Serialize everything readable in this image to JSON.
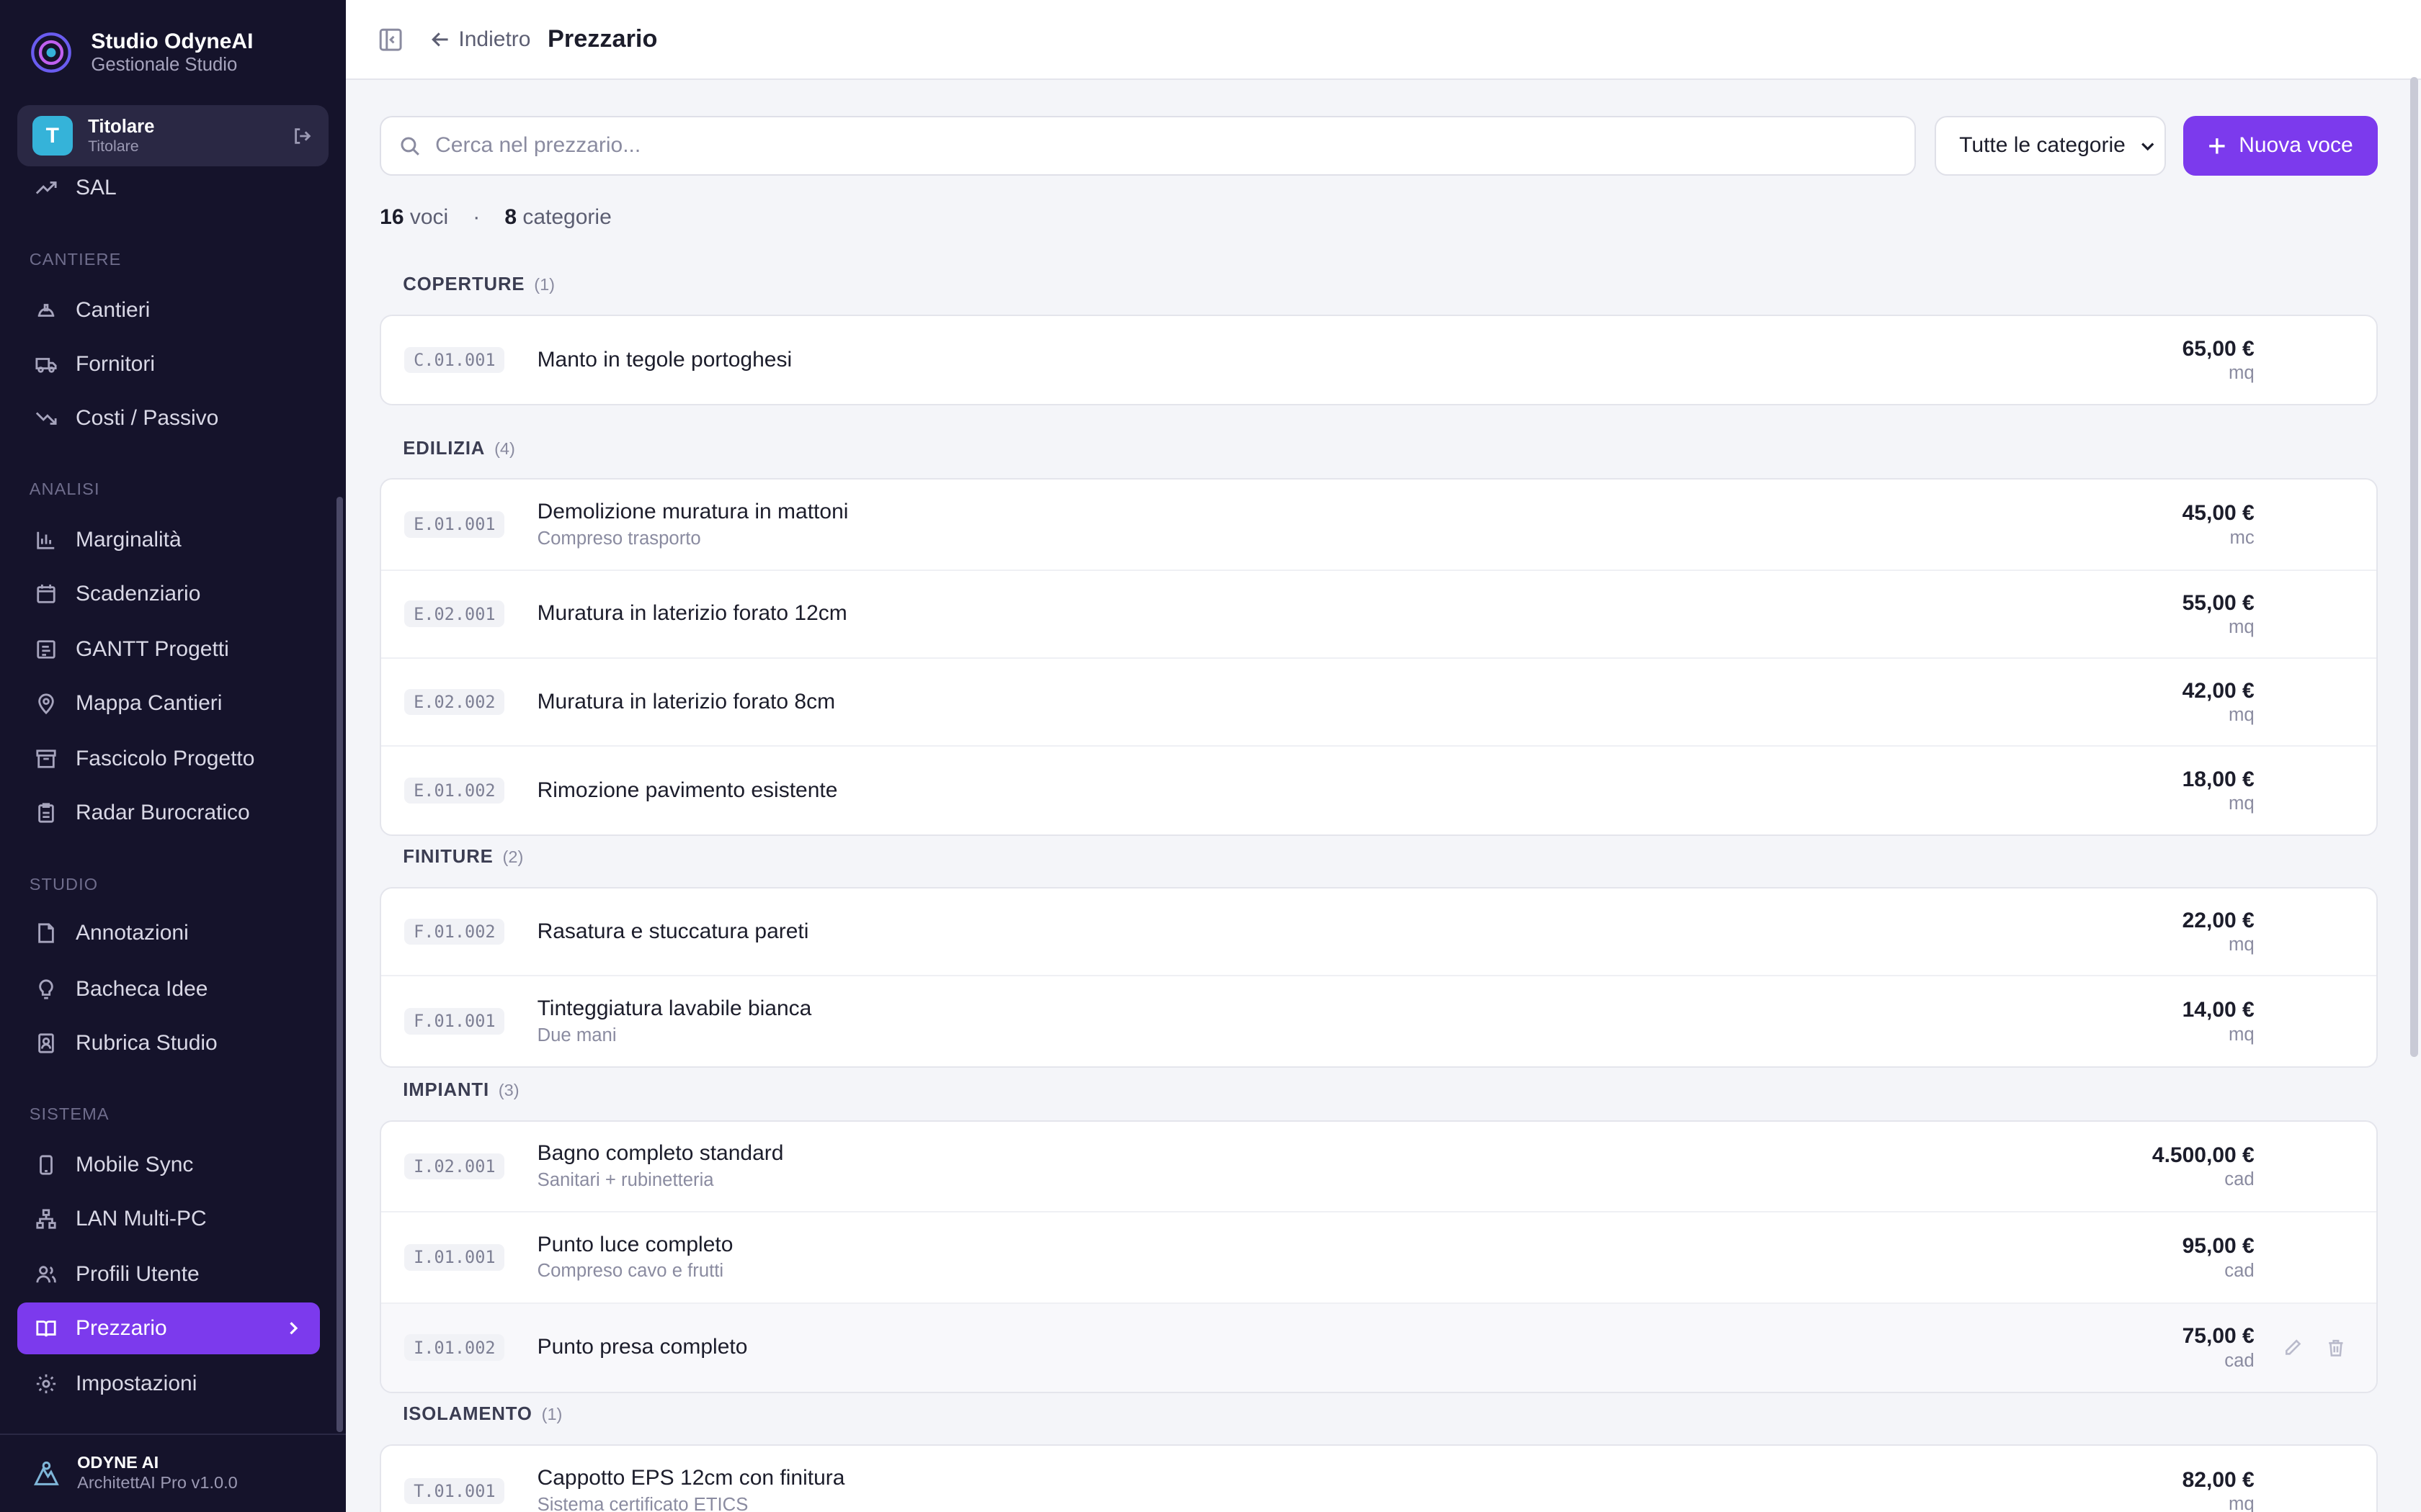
{
  "brand": {
    "title": "Studio OdyneAI",
    "subtitle": "Gestionale Studio"
  },
  "user": {
    "initial": "T",
    "name": "Titolare",
    "role": "Titolare"
  },
  "nav": {
    "sal": "SAL",
    "cantiere_label": "CANTIERE",
    "cantieri": "Cantieri",
    "fornitori": "Fornitori",
    "costi": "Costi / Passivo",
    "analisi_label": "ANALISI",
    "marginalita": "Marginalità",
    "scadenziario": "Scadenziario",
    "gantt": "GANTT Progetti",
    "mappa": "Mappa Cantieri",
    "fascicolo": "Fascicolo Progetto",
    "radar": "Radar Burocratico",
    "studio_label": "STUDIO",
    "annotazioni": "Annotazioni",
    "bacheca": "Bacheca Idee",
    "rubrica": "Rubrica Studio",
    "sistema_label": "SISTEMA",
    "mobile": "Mobile Sync",
    "lan": "LAN Multi-PC",
    "profili": "Profili Utente",
    "prezzario": "Prezzario",
    "impostazioni": "Impostazioni"
  },
  "footer": {
    "title": "ODYNE AI",
    "version": "ArchitettAI Pro v1.0.0"
  },
  "topbar": {
    "back": "Indietro",
    "title": "Prezzario"
  },
  "toolbar": {
    "search_placeholder": "Cerca nel prezzario...",
    "category_select": "Tutte le categorie",
    "new_button": "Nuova voce"
  },
  "counts": {
    "items": "16",
    "items_label": "voci",
    "separator": "·",
    "categories": "8",
    "categories_label": "categorie"
  },
  "categories": [
    {
      "name": "COPERTURE",
      "count": "(1)",
      "items": [
        {
          "code": "C.01.001",
          "title": "Manto in tegole portoghesi",
          "note": "",
          "price": "65,00 €",
          "unit": "mq"
        }
      ]
    },
    {
      "name": "EDILIZIA",
      "count": "(4)",
      "items": [
        {
          "code": "E.01.001",
          "title": "Demolizione muratura in mattoni",
          "note": "Compreso trasporto",
          "price": "45,00 €",
          "unit": "mc"
        },
        {
          "code": "E.02.001",
          "title": "Muratura in laterizio forato 12cm",
          "note": "",
          "price": "55,00 €",
          "unit": "mq"
        },
        {
          "code": "E.02.002",
          "title": "Muratura in laterizio forato 8cm",
          "note": "",
          "price": "42,00 €",
          "unit": "mq"
        },
        {
          "code": "E.01.002",
          "title": "Rimozione pavimento esistente",
          "note": "",
          "price": "18,00 €",
          "unit": "mq"
        }
      ]
    },
    {
      "name": "FINITURE",
      "count": "(2)",
      "items": [
        {
          "code": "F.01.002",
          "title": "Rasatura e stuccatura pareti",
          "note": "",
          "price": "22,00 €",
          "unit": "mq"
        },
        {
          "code": "F.01.001",
          "title": "Tinteggiatura lavabile bianca",
          "note": "Due mani",
          "price": "14,00 €",
          "unit": "mq"
        }
      ]
    },
    {
      "name": "IMPIANTI",
      "count": "(3)",
      "items": [
        {
          "code": "I.02.001",
          "title": "Bagno completo standard",
          "note": "Sanitari + rubinetteria",
          "price": "4.500,00 €",
          "unit": "cad"
        },
        {
          "code": "I.01.001",
          "title": "Punto luce completo",
          "note": "Compreso cavo e frutti",
          "price": "95,00 €",
          "unit": "cad"
        },
        {
          "code": "I.01.002",
          "title": "Punto presa completo",
          "note": "",
          "price": "75,00 €",
          "unit": "cad"
        }
      ]
    },
    {
      "name": "ISOLAMENTO",
      "count": "(1)",
      "items": [
        {
          "code": "T.01.001",
          "title": "Cappotto EPS 12cm con finitura",
          "note": "Sistema certificato ETICS",
          "price": "82,00 €",
          "unit": "mq"
        }
      ]
    }
  ],
  "colors": {
    "sidebar_bg": "#15132b",
    "accent": "#7c3aed",
    "avatar": "#35b3d9"
  }
}
